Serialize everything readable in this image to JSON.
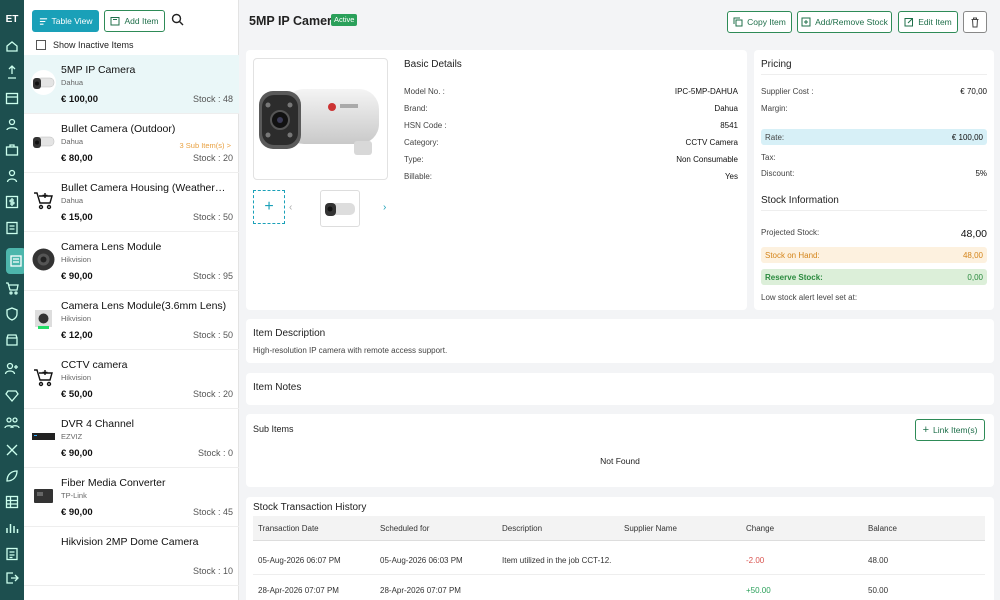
{
  "app": {
    "logo": "ET"
  },
  "toolbar": {
    "table_view": "Table View",
    "add_item": "Add Item"
  },
  "filter": {
    "show_inactive": "Show Inactive Items"
  },
  "items": [
    {
      "name": "5MP IP Camera",
      "brand": "Dahua",
      "price": "€ 100,00",
      "stock": "Stock : 48",
      "sub": "",
      "icon": "bullet-camera"
    },
    {
      "name": "Bullet Camera (Outdoor)",
      "brand": "Dahua",
      "price": "€ 80,00",
      "stock": "Stock : 20",
      "sub": "3 Sub Item(s) >",
      "icon": "bullet-camera"
    },
    {
      "name": "Bullet Camera Housing (Weatherproof)",
      "brand": "Dahua",
      "price": "€ 15,00",
      "stock": "Stock : 50",
      "sub": "",
      "icon": "cart"
    },
    {
      "name": "Camera Lens Module",
      "brand": "Hikvision",
      "price": "€ 90,00",
      "stock": "Stock : 95",
      "sub": "",
      "icon": "lens"
    },
    {
      "name": "Camera Lens Module(3.6mm Lens)",
      "brand": "Hikvision",
      "price": "€ 12,00",
      "stock": "Stock : 50",
      "sub": "",
      "icon": "module"
    },
    {
      "name": "CCTV camera",
      "brand": "Hikvision",
      "price": "€ 50,00",
      "stock": "Stock : 20",
      "sub": "",
      "icon": "cart"
    },
    {
      "name": "DVR 4 Channel",
      "brand": "EZVIZ",
      "price": "€ 90,00",
      "stock": "Stock : 0",
      "sub": "",
      "icon": "dvr"
    },
    {
      "name": "Fiber Media Converter",
      "brand": "TP-Link",
      "price": "€ 90,00",
      "stock": "Stock : 45",
      "sub": "",
      "icon": "converter"
    },
    {
      "name": "Hikvision 2MP Dome Camera",
      "brand": "",
      "price": "",
      "stock": "Stock : 10",
      "sub": "",
      "icon": "dome"
    }
  ],
  "detail": {
    "title": "5MP IP Camera",
    "status": "Active",
    "actions": {
      "copy": "Copy Item",
      "stock": "Add/Remove Stock",
      "edit": "Edit Item"
    },
    "basic": {
      "heading": "Basic Details",
      "rows": [
        {
          "label": "Model No. :",
          "value": "IPC-5MP-DAHUA"
        },
        {
          "label": "Brand:",
          "value": "Dahua"
        },
        {
          "label": "HSN Code :",
          "value": "8541"
        },
        {
          "label": "Category:",
          "value": "CCTV Camera"
        },
        {
          "label": "Type:",
          "value": "Non Consumable"
        },
        {
          "label": "Billable:",
          "value": "Yes"
        }
      ]
    },
    "pricing": {
      "heading": "Pricing",
      "supplier_cost_label": "Supplier Cost :",
      "supplier_cost": "€ 70,00",
      "margin_label": "Margin:",
      "rate_label": "Rate:",
      "rate": "€ 100,00",
      "tax_label": "Tax:",
      "discount_label": "Discount:",
      "discount": "5%"
    },
    "stock": {
      "heading": "Stock Information",
      "projected_label": "Projected Stock:",
      "projected": "48,00",
      "onhand_label": "Stock on Hand:",
      "onhand": "48,00",
      "reserve_label": "Reserve Stock:",
      "reserve": "0,00",
      "alert_label": "Low stock alert level set at:"
    },
    "description": {
      "heading": "Item Description",
      "text": "High-resolution IP camera with remote access support."
    },
    "notes": {
      "heading": "Item Notes"
    },
    "subitems": {
      "heading": "Sub Items",
      "link_button": "Link Item(s)",
      "empty": "Not Found"
    },
    "history": {
      "heading": "Stock Transaction History",
      "columns": [
        "Transaction Date",
        "Scheduled for",
        "Description",
        "Supplier Name",
        "Change",
        "Balance"
      ],
      "rows": [
        {
          "date": "05-Aug-2026 06:07 PM",
          "scheduled": "05-Aug-2026 06:03 PM",
          "desc": "Item utilized in the job CCT-12.",
          "supplier": "",
          "change": "-2.00",
          "balance": "48.00"
        },
        {
          "date": "28-Apr-2026 07:07 PM",
          "scheduled": "28-Apr-2026 07:07 PM",
          "desc": "",
          "supplier": "",
          "change": "+50.00",
          "balance": "50.00"
        }
      ]
    }
  },
  "colors": {
    "nav": "#1d4f4f",
    "accent": "#1aa0b8",
    "active_badge": "#2aa05a",
    "negative": "#d9534f",
    "positive": "#2aa05a"
  }
}
